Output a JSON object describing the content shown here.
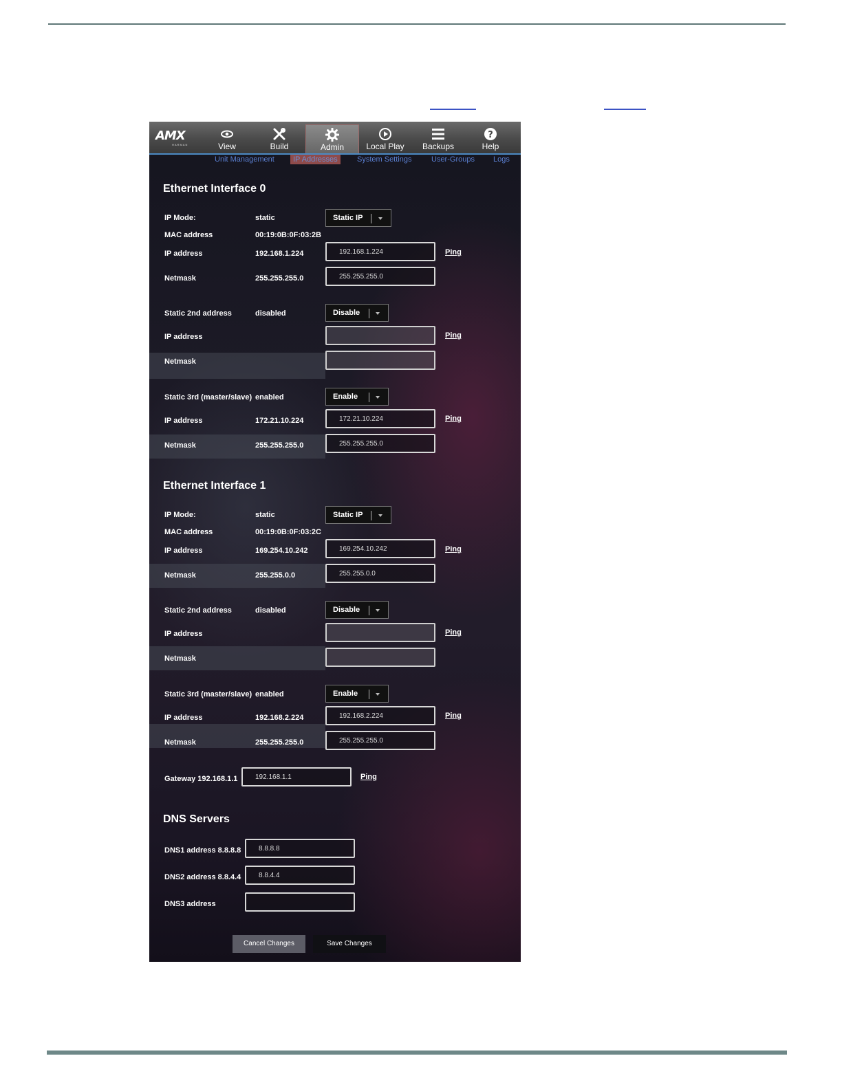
{
  "nav": {
    "logo": "AMX",
    "logo_sub": "HARMAN",
    "items": [
      {
        "label": "View",
        "icon": "eye-icon"
      },
      {
        "label": "Build",
        "icon": "tools-icon"
      },
      {
        "label": "Admin",
        "icon": "gear-icon"
      },
      {
        "label": "Local Play",
        "icon": "play-icon"
      },
      {
        "label": "Backups",
        "icon": "menu-icon"
      },
      {
        "label": "Help",
        "icon": "help-icon"
      }
    ],
    "active": "Admin",
    "subnav": [
      "Unit Management",
      "IP Addresses",
      "System Settings",
      "User-Groups",
      "Logs"
    ],
    "subnav_active": "IP Addresses"
  },
  "eth0": {
    "title": "Ethernet Interface 0",
    "ip_mode": {
      "label": "IP Mode:",
      "value": "static",
      "select": "Static IP"
    },
    "mac": {
      "label": "MAC address",
      "value": "00:19:0B:0F:03:2B"
    },
    "ip": {
      "label": "IP address",
      "value": "192.168.1.224",
      "input": "192.168.1.224",
      "ping": "Ping"
    },
    "netmask": {
      "label": "Netmask",
      "value": "255.255.255.0",
      "input": "255.255.255.0"
    },
    "second": {
      "label": "Static 2nd address",
      "value": "disabled",
      "select": "Disable",
      "ip_label": "IP address",
      "ping": "Ping",
      "netmask_label": "Netmask"
    },
    "third": {
      "label": "Static 3rd (master/slave)",
      "value": "enabled",
      "select": "Enable",
      "ip_label": "IP address",
      "ip_value": "172.21.10.224",
      "ip_input": "172.21.10.224",
      "ping": "Ping",
      "netmask_label": "Netmask",
      "netmask_value": "255.255.255.0",
      "netmask_input": "255.255.255.0"
    }
  },
  "eth1": {
    "title": "Ethernet Interface 1",
    "ip_mode": {
      "label": "IP Mode:",
      "value": "static",
      "select": "Static IP"
    },
    "mac": {
      "label": "MAC address",
      "value": "00:19:0B:0F:03:2C"
    },
    "ip": {
      "label": "IP address",
      "value": "169.254.10.242",
      "input": "169.254.10.242",
      "ping": "Ping"
    },
    "netmask": {
      "label": "Netmask",
      "value": "255.255.0.0",
      "input": "255.255.0.0"
    },
    "second": {
      "label": "Static 2nd address",
      "value": "disabled",
      "select": "Disable",
      "ip_label": "IP address",
      "ping": "Ping",
      "netmask_label": "Netmask"
    },
    "third": {
      "label": "Static 3rd (master/slave)",
      "value": "enabled",
      "select": "Enable",
      "ip_label": "IP address",
      "ip_value": "192.168.2.224",
      "ip_input": "192.168.2.224",
      "ping": "Ping",
      "netmask_label": "Netmask",
      "netmask_value": "255.255.255.0",
      "netmask_input": "255.255.255.0"
    }
  },
  "gateway": {
    "label": "Gateway 192.168.1.1",
    "input": "192.168.1.1",
    "ping": "Ping"
  },
  "dns": {
    "title": "DNS Servers",
    "dns1": {
      "label": "DNS1 address 8.8.8.8",
      "input": "8.8.8.8"
    },
    "dns2": {
      "label": "DNS2 address 8.8.4.4",
      "input": "8.8.4.4"
    },
    "dns3": {
      "label": "DNS3 address",
      "input": ""
    }
  },
  "actions": {
    "cancel": "Cancel Changes",
    "save": "Save Changes"
  },
  "colors": {
    "link": "#3b52c4",
    "subnav": "#5a7fd0",
    "active_tab": "#8f4b4b",
    "accent_line": "#4c8ac4"
  }
}
